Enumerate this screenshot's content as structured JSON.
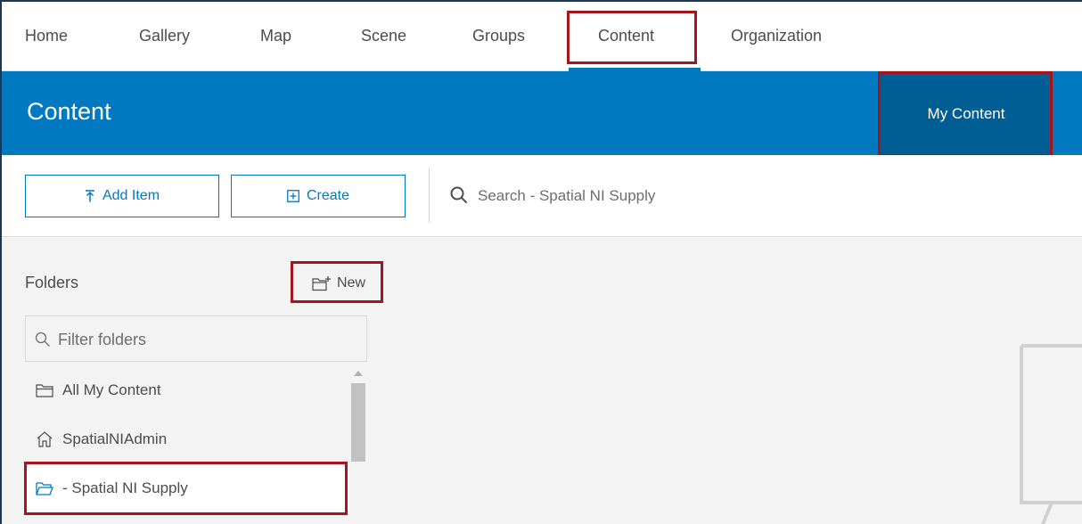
{
  "nav": {
    "items": [
      {
        "label": "Home"
      },
      {
        "label": "Gallery"
      },
      {
        "label": "Map"
      },
      {
        "label": "Scene"
      },
      {
        "label": "Groups"
      },
      {
        "label": "Content"
      },
      {
        "label": "Organization"
      }
    ],
    "active": "Content"
  },
  "header": {
    "title": "Content",
    "tab_label": "My Content"
  },
  "toolbar": {
    "add_item_label": "Add Item",
    "create_label": "Create",
    "search_placeholder": "Search - Spatial NI Supply"
  },
  "sidebar": {
    "folders_label": "Folders",
    "new_label": "New",
    "filter_placeholder": "Filter folders",
    "folders": [
      {
        "label": "All My Content",
        "icon": "folder-icon"
      },
      {
        "label": "SpatialNIAdmin",
        "icon": "home-icon"
      },
      {
        "label": "- Spatial NI Supply",
        "icon": "folder-open-icon",
        "selected": true
      }
    ]
  },
  "colors": {
    "brand_blue": "#0079c1",
    "active_tab": "#005e95",
    "highlight_red": "#a8141b",
    "background": "#f3f3f3"
  }
}
